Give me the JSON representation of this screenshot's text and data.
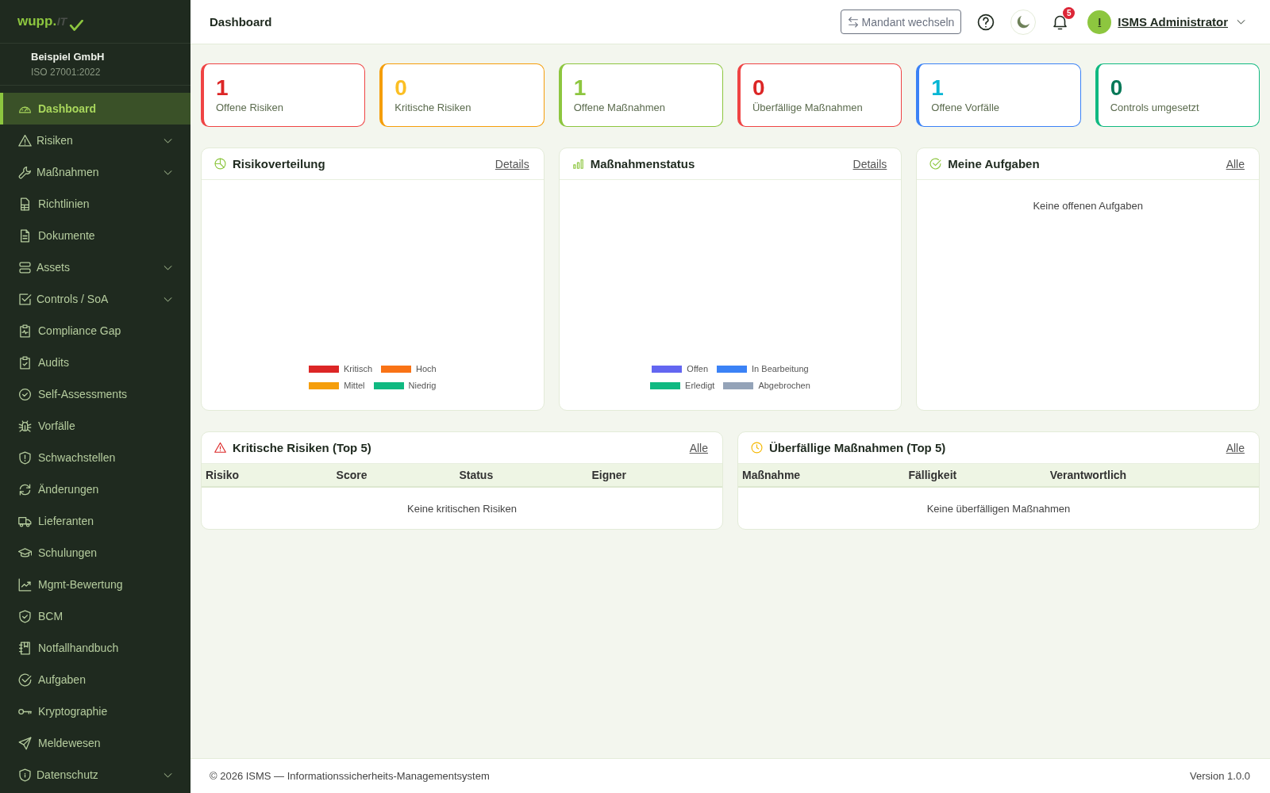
{
  "sidebar": {
    "logo": {
      "wordmark": "wupp.",
      "suffix": "IT"
    },
    "org": {
      "name": "Beispiel GmbH",
      "standard": "ISO 27001:2022"
    },
    "items": [
      {
        "label": "Dashboard",
        "kind": "link",
        "selected": true
      },
      {
        "label": "Risiken",
        "kind": "group",
        "expanded": false,
        "selected": false
      },
      {
        "label": "Maßnahmen",
        "kind": "group",
        "expanded": false,
        "selected": false
      },
      {
        "label": "Richtlinien",
        "kind": "link",
        "selected": false
      },
      {
        "label": "Dokumente",
        "kind": "link",
        "selected": false
      },
      {
        "label": "Assets",
        "kind": "group",
        "expanded": false,
        "selected": false
      },
      {
        "label": "Controls / SoA",
        "kind": "group",
        "expanded": false,
        "selected": false
      },
      {
        "label": "Compliance Gap",
        "kind": "link",
        "selected": false
      },
      {
        "label": "Audits",
        "kind": "link",
        "selected": false
      },
      {
        "label": "Self-Assessments",
        "kind": "link",
        "selected": false
      },
      {
        "label": "Vorfälle",
        "kind": "link",
        "selected": false
      },
      {
        "label": "Schwachstellen",
        "kind": "link",
        "selected": false
      },
      {
        "label": "Änderungen",
        "kind": "link",
        "selected": false
      },
      {
        "label": "Lieferanten",
        "kind": "link",
        "selected": false
      },
      {
        "label": "Schulungen",
        "kind": "link",
        "selected": false
      },
      {
        "label": "Mgmt-Bewertung",
        "kind": "link",
        "selected": false
      },
      {
        "label": "BCM",
        "kind": "link",
        "selected": false
      },
      {
        "label": "Notfallhandbuch",
        "kind": "link",
        "selected": false
      },
      {
        "label": "Aufgaben",
        "kind": "link",
        "selected": false
      },
      {
        "label": "Kryptographie",
        "kind": "link",
        "selected": false
      },
      {
        "label": "Meldewesen",
        "kind": "link",
        "selected": false
      },
      {
        "label": "Datenschutz",
        "kind": "group",
        "expanded": false,
        "selected": false
      }
    ]
  },
  "header": {
    "title": "Dashboard",
    "switch_button": "Mandant wechseln",
    "notifications": "5",
    "user": {
      "initial": "I",
      "name": "ISMS Administrator"
    }
  },
  "stats": [
    {
      "value": {
        "text": "1",
        "color": "#dc2626"
      },
      "label": "Offene Risiken",
      "color": "#ef4444"
    },
    {
      "value": {
        "text": "0",
        "color": "#fbbf24"
      },
      "label": "Kritische Risiken",
      "color": "#f59e0b"
    },
    {
      "value": {
        "text": "1",
        "color": "#8dc63f"
      },
      "label": "Offene Maßnahmen",
      "color": "#8dc63f"
    },
    {
      "value": {
        "text": "0",
        "color": "#dc2626"
      },
      "label": "Überfällige Maßnahmen",
      "color": "#ef4444"
    },
    {
      "value": {
        "text": "1",
        "color": "#06b6d4"
      },
      "label": "Offene Vorfälle",
      "color": "#3b82f6"
    },
    {
      "value": {
        "text": "0",
        "color": "#047857"
      },
      "label": "Controls umgesetzt",
      "color": "#10b981"
    }
  ],
  "panels": [
    {
      "kind": "chart",
      "title": "Risikoverteilung",
      "link": "Details",
      "legend": [
        {
          "label": "Kritisch",
          "color": "#dc2626"
        },
        {
          "label": "Hoch",
          "color": "#f97316"
        },
        {
          "label": "Mittel",
          "color": "#f59e0b"
        },
        {
          "label": "Niedrig",
          "color": "#10b981"
        }
      ]
    },
    {
      "kind": "chart",
      "title": "Maßnahmenstatus",
      "link": "Details",
      "legend": [
        {
          "label": "Offen",
          "color": "#6366f1"
        },
        {
          "label": "In Bearbeitung",
          "color": "#3b82f6"
        },
        {
          "label": "Erledigt",
          "color": "#10b981"
        },
        {
          "label": "Abgebrochen",
          "color": "#94a3b8"
        }
      ]
    },
    {
      "kind": "list",
      "title": "Meine Aufgaben",
      "link": "Alle",
      "empty": "Keine offenen Aufgaben"
    }
  ],
  "tables": [
    {
      "title": "Kritische Risiken (Top 5)",
      "link": "Alle",
      "columns": [
        "Risiko",
        "Score",
        "Status",
        "Eigner"
      ],
      "empty": "Keine kritischen Risiken"
    },
    {
      "title": "Überfällige Maßnahmen (Top 5)",
      "link": "Alle",
      "columns": [
        "Maßnahme",
        "Fälligkeit",
        "Verantwortlich"
      ],
      "empty": "Keine überfälligen Maßnahmen"
    }
  ],
  "footer": {
    "copyright": "© 2026 ISMS — Informationssicherheits-Managementsystem",
    "version": "Version 1.0.0"
  }
}
